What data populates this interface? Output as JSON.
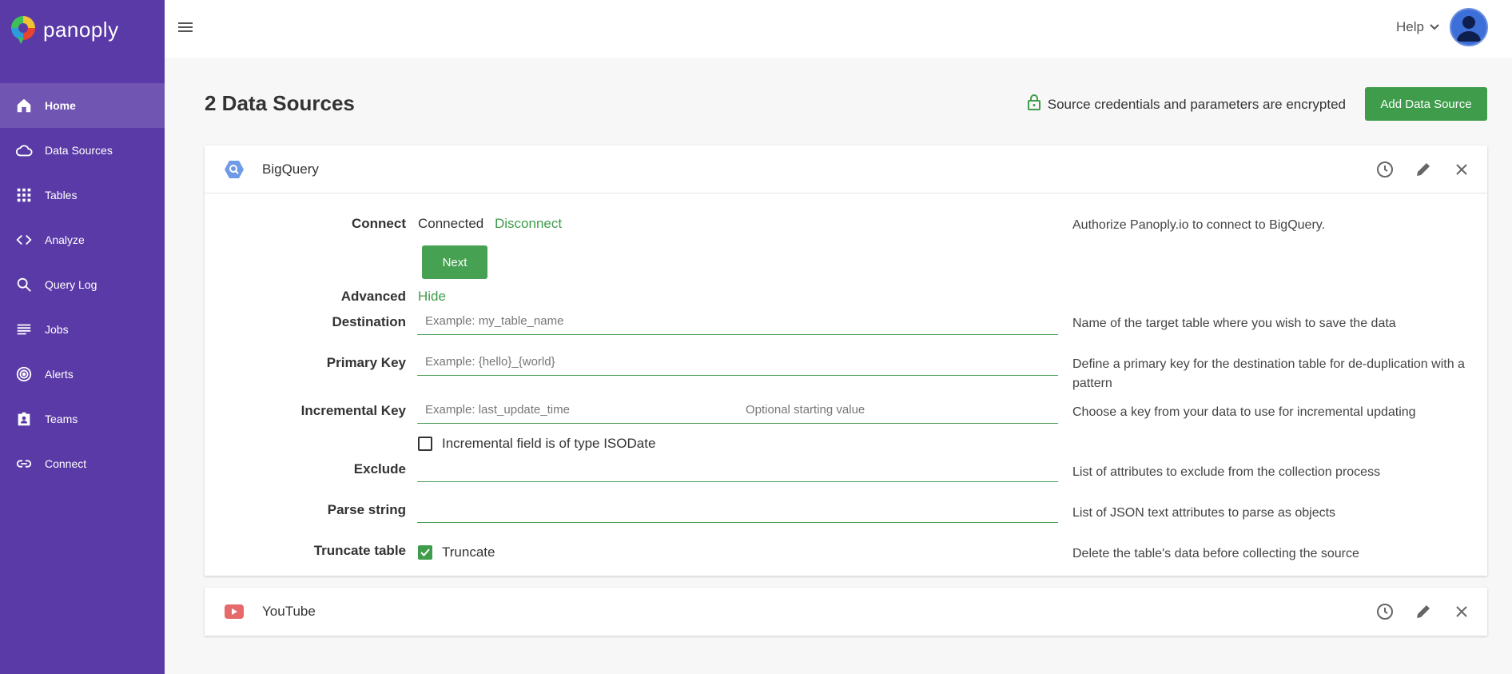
{
  "app": {
    "logo_text": "panoply"
  },
  "sidebar": {
    "items": [
      {
        "label": "Home",
        "icon": "home-icon"
      },
      {
        "label": "Data Sources",
        "icon": "cloud-icon"
      },
      {
        "label": "Tables",
        "icon": "grid-icon"
      },
      {
        "label": "Analyze",
        "icon": "code-icon"
      },
      {
        "label": "Query Log",
        "icon": "search-icon"
      },
      {
        "label": "Jobs",
        "icon": "list-icon"
      },
      {
        "label": "Alerts",
        "icon": "alert-icon"
      },
      {
        "label": "Teams",
        "icon": "badge-icon"
      },
      {
        "label": "Connect",
        "icon": "link-icon"
      }
    ]
  },
  "topbar": {
    "help_label": "Help"
  },
  "header": {
    "title": "2 Data Sources",
    "encryption_note": "Source credentials and parameters are encrypted",
    "add_button": "Add Data Source"
  },
  "sources": [
    {
      "name": "BigQuery",
      "form": {
        "connect_label": "Connect",
        "connected_text": "Connected",
        "disconnect_link": "Disconnect",
        "next_button": "Next",
        "connect_desc": "Authorize Panoply.io to connect to BigQuery.",
        "advanced_label": "Advanced",
        "hide_link": "Hide",
        "destination_label": "Destination",
        "destination_placeholder": "Example: my_table_name",
        "destination_desc": "Name of the target table where you wish to save the data",
        "primary_key_label": "Primary Key",
        "primary_key_placeholder": "Example: {hello}_{world}",
        "primary_key_desc": "Define a primary key for the destination table for de-duplication with a pattern",
        "incremental_key_label": "Incremental Key",
        "incremental_key_placeholder": "Example: last_update_time",
        "incremental_start_placeholder": "Optional starting value",
        "incremental_key_desc": "Choose a key from your data to use for incremental updating",
        "isodate_label": "Incremental field is of type ISODate",
        "isodate_checked": false,
        "exclude_label": "Exclude",
        "exclude_desc": "List of attributes to exclude from the collection process",
        "parse_label": "Parse string",
        "parse_desc": "List of JSON text attributes to parse as objects",
        "truncate_label": "Truncate table",
        "truncate_checkbox_label": "Truncate",
        "truncate_checked": true,
        "truncate_desc": "Delete the table's data before collecting the source"
      }
    },
    {
      "name": "YouTube"
    }
  ],
  "colors": {
    "sidebar": "#5a3aa6",
    "accent": "#3e9c4a"
  }
}
